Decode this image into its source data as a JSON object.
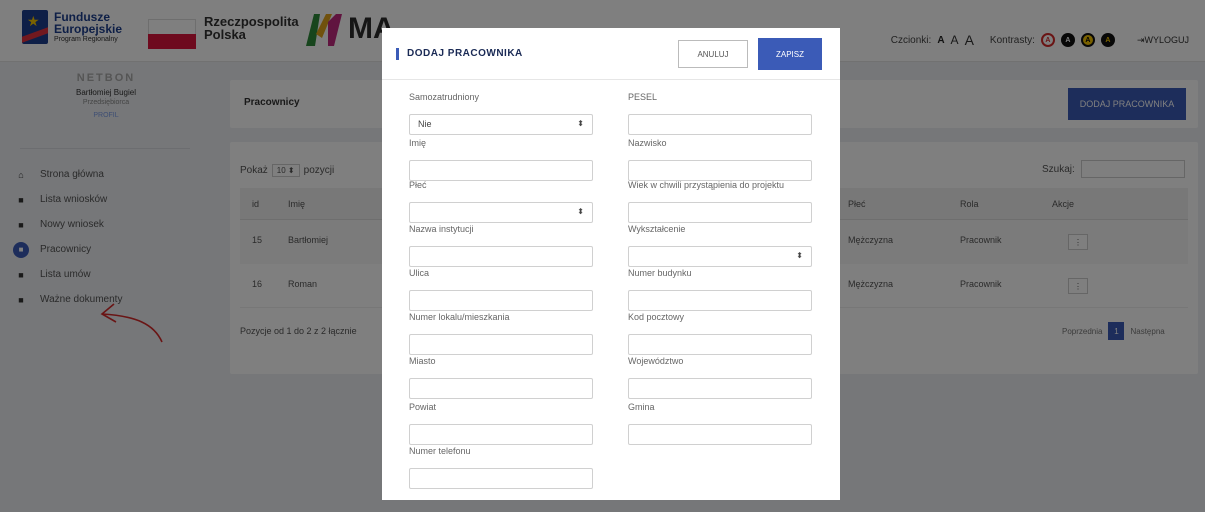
{
  "header": {
    "fe_line1": "Fundusze",
    "fe_line2": "Europejskie",
    "fe_line3": "Program Regionalny",
    "rp_line1": "Rzeczpospolita",
    "rp_line2": "Polska",
    "brand_partial": "MA",
    "fonts_label": "Czcionki:",
    "font_small": "A",
    "font_medium": "A",
    "font_large": "A",
    "contrast_label": "Kontrasty:",
    "contrast_glyph": "A",
    "logout": "WYLOGUJ"
  },
  "sidebar": {
    "company": "NETBON",
    "user_name": "Bartłomiej Bugiel",
    "user_role": "Przedsiębiorca",
    "profile_link": "PROFIL",
    "items": [
      {
        "label": "Strona główna",
        "icon": "home-icon"
      },
      {
        "label": "Lista wniosków",
        "icon": "file-icon"
      },
      {
        "label": "Nowy wniosek",
        "icon": "file-icon"
      },
      {
        "label": "Pracownicy",
        "icon": "file-icon"
      },
      {
        "label": "Lista umów",
        "icon": "file-icon"
      },
      {
        "label": "Ważne dokumenty",
        "icon": "file-icon"
      }
    ]
  },
  "content": {
    "title": "Pracownicy",
    "add_button": "DODAJ PRACOWNIKA",
    "show_label": "Pokaż",
    "show_value": "10",
    "show_suffix": "pozycji",
    "search_label": "Szukaj:",
    "columns": {
      "id": "id",
      "imie": "Imię",
      "plec": "Płeć",
      "rola": "Rola",
      "akcje": "Akcje"
    },
    "rows": [
      {
        "id": "15",
        "imie": "Bartłomiej",
        "plec": "Mężczyzna",
        "rola": "Pracownik"
      },
      {
        "id": "16",
        "imie": "Roman",
        "plec": "Mężczyzna",
        "rola": "Pracownik"
      }
    ],
    "info": "Pozycje od 1 do 2 z 2 łącznie",
    "prev": "Poprzednia",
    "page": "1",
    "next": "Następna"
  },
  "modal": {
    "title": "DODAJ PRACOWNIKA",
    "cancel": "ANULUJ",
    "save": "ZAPISZ",
    "fields": [
      {
        "label": "Samozatrudniony",
        "value": "Nie",
        "select": true
      },
      {
        "label": "PESEL",
        "value": ""
      },
      {
        "label": "Imię",
        "value": ""
      },
      {
        "label": "Nazwisko",
        "value": ""
      },
      {
        "label": "Płeć",
        "value": "",
        "select": true
      },
      {
        "label": "Wiek w chwili przystąpienia do projektu",
        "value": ""
      },
      {
        "label": "Nazwa instytucji",
        "value": ""
      },
      {
        "label": "Wykształcenie",
        "value": "",
        "select": true
      },
      {
        "label": "Ulica",
        "value": ""
      },
      {
        "label": "Numer budynku",
        "value": ""
      },
      {
        "label": "Numer lokalu/mieszkania",
        "value": ""
      },
      {
        "label": "Kod pocztowy",
        "value": ""
      },
      {
        "label": "Miasto",
        "value": ""
      },
      {
        "label": "Województwo",
        "value": ""
      },
      {
        "label": "Powiat",
        "value": ""
      },
      {
        "label": "Gmina",
        "value": ""
      },
      {
        "label": "Numer telefonu",
        "value": ""
      }
    ]
  }
}
